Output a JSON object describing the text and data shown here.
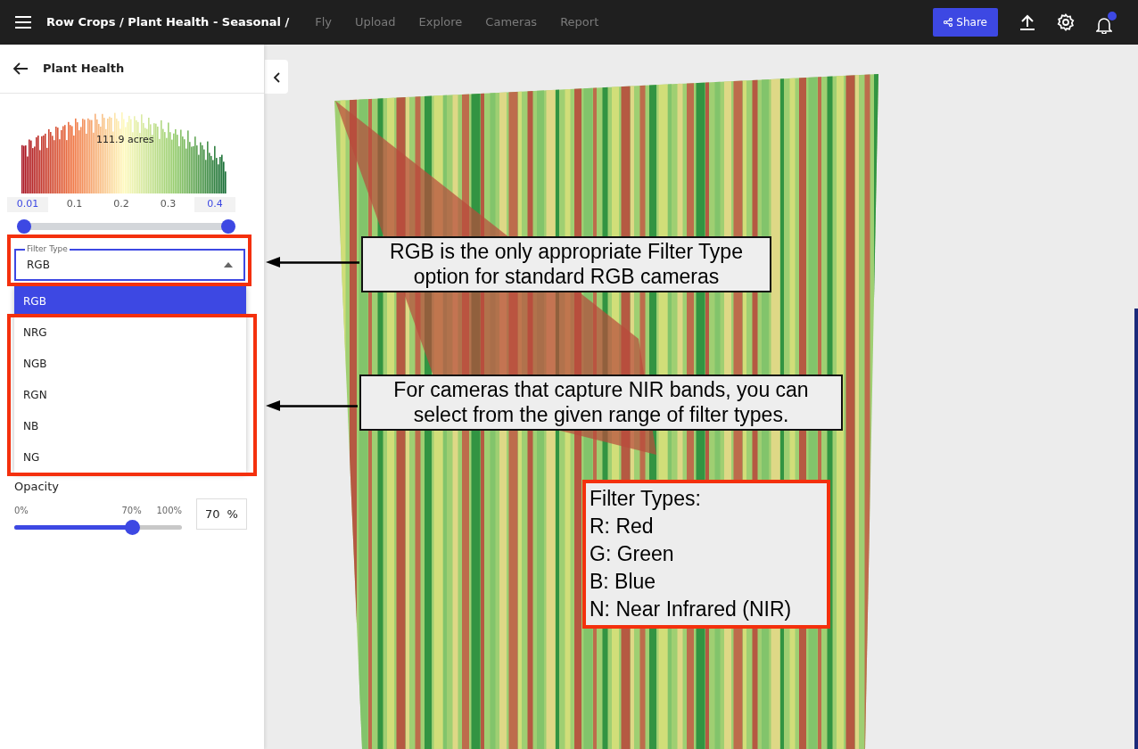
{
  "topbar": {
    "breadcrumb": "Row Crops / Plant Health - Seasonal /",
    "links": [
      {
        "label": "Fly"
      },
      {
        "label": "Upload"
      },
      {
        "label": "Explore"
      },
      {
        "label": "Cameras"
      },
      {
        "label": "Report"
      }
    ],
    "share": "Share",
    "has_notification": true
  },
  "panel": {
    "title": "Plant Health",
    "histogram": {
      "area": "111.9 acres",
      "axis": [
        "0.01",
        "0.1",
        "0.2",
        "0.3",
        "0.4"
      ],
      "range": [
        {
          "level": 0
        },
        {
          "level": 1
        }
      ]
    },
    "filter_type": {
      "label": "Filter Type",
      "value": "RGB",
      "options": [
        {
          "label": "RGB",
          "selected": true
        },
        {
          "label": "NRG",
          "selected": false
        },
        {
          "label": "NGB",
          "selected": false
        },
        {
          "label": "RGN",
          "selected": false
        },
        {
          "label": "NB",
          "selected": false
        },
        {
          "label": "NG",
          "selected": false
        }
      ]
    },
    "opacity": {
      "label": "Opacity",
      "ticks": [
        "0%",
        "70%",
        "100%"
      ],
      "level": 0.7,
      "value": "70",
      "unit": "%"
    }
  },
  "annotations": [
    {
      "kind": "callout",
      "text": "RGB is the only appropriate Filter Type option for standard RGB cameras"
    },
    {
      "kind": "callout",
      "text": "For cameras that capture NIR bands, you can select from the given range of filter types."
    },
    {
      "kind": "legend",
      "lines": [
        "Filter Types:",
        "R: Red",
        "G: Green",
        "B: Blue",
        "N: Near Infrared (NIR)"
      ]
    }
  ]
}
